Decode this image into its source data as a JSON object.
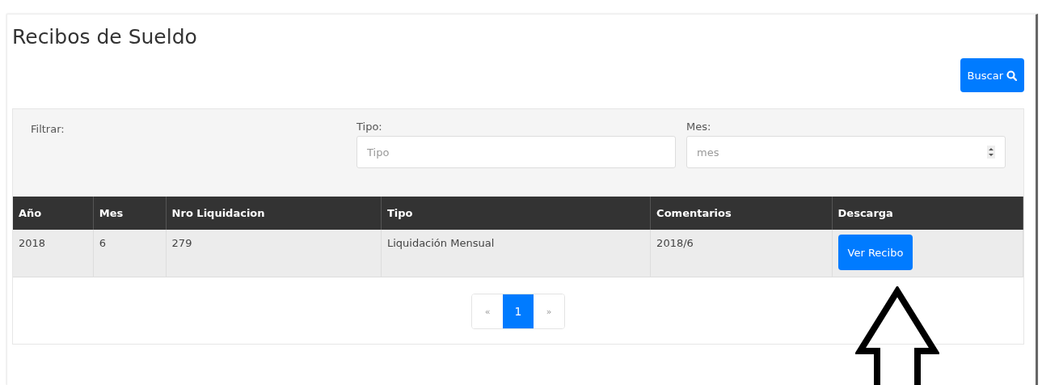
{
  "title": "Recibos de Sueldo",
  "search_button": "Buscar",
  "filter": {
    "label": "Filtrar:",
    "fields": [
      {
        "label": "Tipo:",
        "placeholder": "Tipo",
        "kind": "text"
      },
      {
        "label": "Mes:",
        "placeholder": "mes",
        "kind": "number"
      }
    ]
  },
  "table": {
    "columns": [
      "Año",
      "Mes",
      "Nro Liquidacion",
      "Tipo",
      "Comentarios",
      "Descarga"
    ],
    "rows": [
      {
        "cells": [
          "2018",
          "6",
          "279",
          "Liquidación Mensual",
          "2018/6"
        ],
        "button": "Ver Recibo"
      }
    ]
  },
  "pagination": [
    {
      "label": "«",
      "selected": false
    },
    {
      "label": "1",
      "selected": true
    },
    {
      "label": "»",
      "selected": false
    }
  ]
}
